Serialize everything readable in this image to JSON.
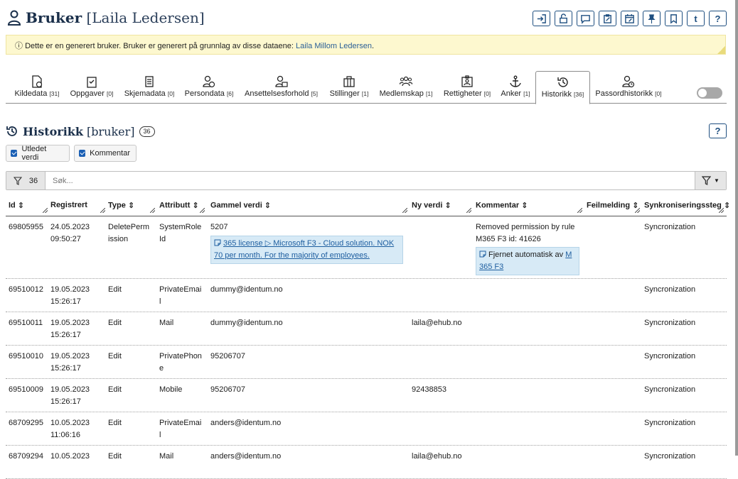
{
  "header": {
    "title": "Bruker",
    "subtitle": "[Laila Ledersen]",
    "help_label": "?",
    "t_label": "t"
  },
  "notice": {
    "text": "Dette er en generert bruker. Bruker er generert på grunnlag av disse dataene: ",
    "link": "Laila Millom Ledersen",
    "tail": "."
  },
  "tabs": [
    {
      "label": "Kildedata",
      "count": "[31]",
      "icon": "file-info-icon"
    },
    {
      "label": "Oppgaver",
      "count": "[0]",
      "icon": "clipboard-check-icon"
    },
    {
      "label": "Skjemadata",
      "count": "[0]",
      "icon": "form-icon"
    },
    {
      "label": "Persondata",
      "count": "[6]",
      "icon": "person-info-icon"
    },
    {
      "label": "Ansettelsesforhold",
      "count": "[5]",
      "icon": "person-badge-icon"
    },
    {
      "label": "Stillinger",
      "count": "[1]",
      "icon": "briefcase-icon"
    },
    {
      "label": "Medlemskap",
      "count": "[1]",
      "icon": "group-icon"
    },
    {
      "label": "Rettigheter",
      "count": "[0]",
      "icon": "id-card-icon"
    },
    {
      "label": "Anker",
      "count": "[1]",
      "icon": "anchor-icon"
    },
    {
      "label": "Historikk",
      "count": "[36]",
      "icon": "history-icon"
    },
    {
      "label": "Passordhistorikk",
      "count": "[0]",
      "icon": "person-clock-icon"
    }
  ],
  "section": {
    "title": "Historikk",
    "qualifier": "[bruker]",
    "count": "36",
    "help_label": "?"
  },
  "toggles": {
    "derived_label": "Utledet verdi",
    "comment_label": "Kommentar"
  },
  "filter": {
    "count": "36",
    "placeholder": "Søk..."
  },
  "columns": [
    "Id",
    "Registrert",
    "Type",
    "Attributt",
    "Gammel verdi",
    "Ny verdi",
    "Kommentar",
    "Feilmelding",
    "Synkroniseringssteg"
  ],
  "rows": [
    {
      "id": "69805955",
      "date": "24.05.2023",
      "time": "09:50:27",
      "type_1": "DeletePerm",
      "type_2": "ission",
      "attr_1": "SystemRole",
      "attr_2": "Id",
      "old": "5207",
      "old_chip_link": "365 license ▷ Microsoft F3 - Cloud solution. NOK 70 per month. For the majority of employees.",
      "new": "",
      "comment_1": "Removed permission by rule",
      "comment_2": "M365 F3 id: 41626",
      "comment_chip_text": "Fjernet automatisk av ",
      "comment_chip_link": "M 365 F3",
      "error": "",
      "sync": "Syncronization"
    },
    {
      "id": "69510012",
      "date": "19.05.2023",
      "time": "15:26:17",
      "type": "Edit",
      "attr_1": "PrivateEmai",
      "attr_2": "l",
      "old": "dummy@identum.no",
      "new": "",
      "comment": "",
      "error": "",
      "sync": "Syncronization"
    },
    {
      "id": "69510011",
      "date": "19.05.2023",
      "time": "15:26:17",
      "type": "Edit",
      "attr_1": "Mail",
      "attr_2": "",
      "old": "dummy@identum.no",
      "new": "laila@ehub.no",
      "comment": "",
      "error": "",
      "sync": "Syncronization"
    },
    {
      "id": "69510010",
      "date": "19.05.2023",
      "time": "15:26:17",
      "type": "Edit",
      "attr_1": "PrivatePhon",
      "attr_2": "e",
      "old": "95206707",
      "new": "",
      "comment": "",
      "error": "",
      "sync": "Syncronization"
    },
    {
      "id": "69510009",
      "date": "19.05.2023",
      "time": "15:26:17",
      "type": "Edit",
      "attr_1": "Mobile",
      "attr_2": "",
      "old": "95206707",
      "new": "92438853",
      "comment": "",
      "error": "",
      "sync": "Syncronization"
    },
    {
      "id": "68709295",
      "date": "10.05.2023",
      "time": "11:06:16",
      "type": "Edit",
      "attr_1": "PrivateEmai",
      "attr_2": "l",
      "old": "anders@identum.no",
      "new": "",
      "comment": "",
      "error": "",
      "sync": "Syncronization"
    },
    {
      "id": "68709294",
      "date": "10.05.2023",
      "time": "",
      "type": "Edit",
      "attr_1": "Mail",
      "attr_2": "",
      "old": "anders@identum.no",
      "new": "laila@ehub.no",
      "comment": "",
      "error": "",
      "sync": "Syncronization"
    }
  ]
}
